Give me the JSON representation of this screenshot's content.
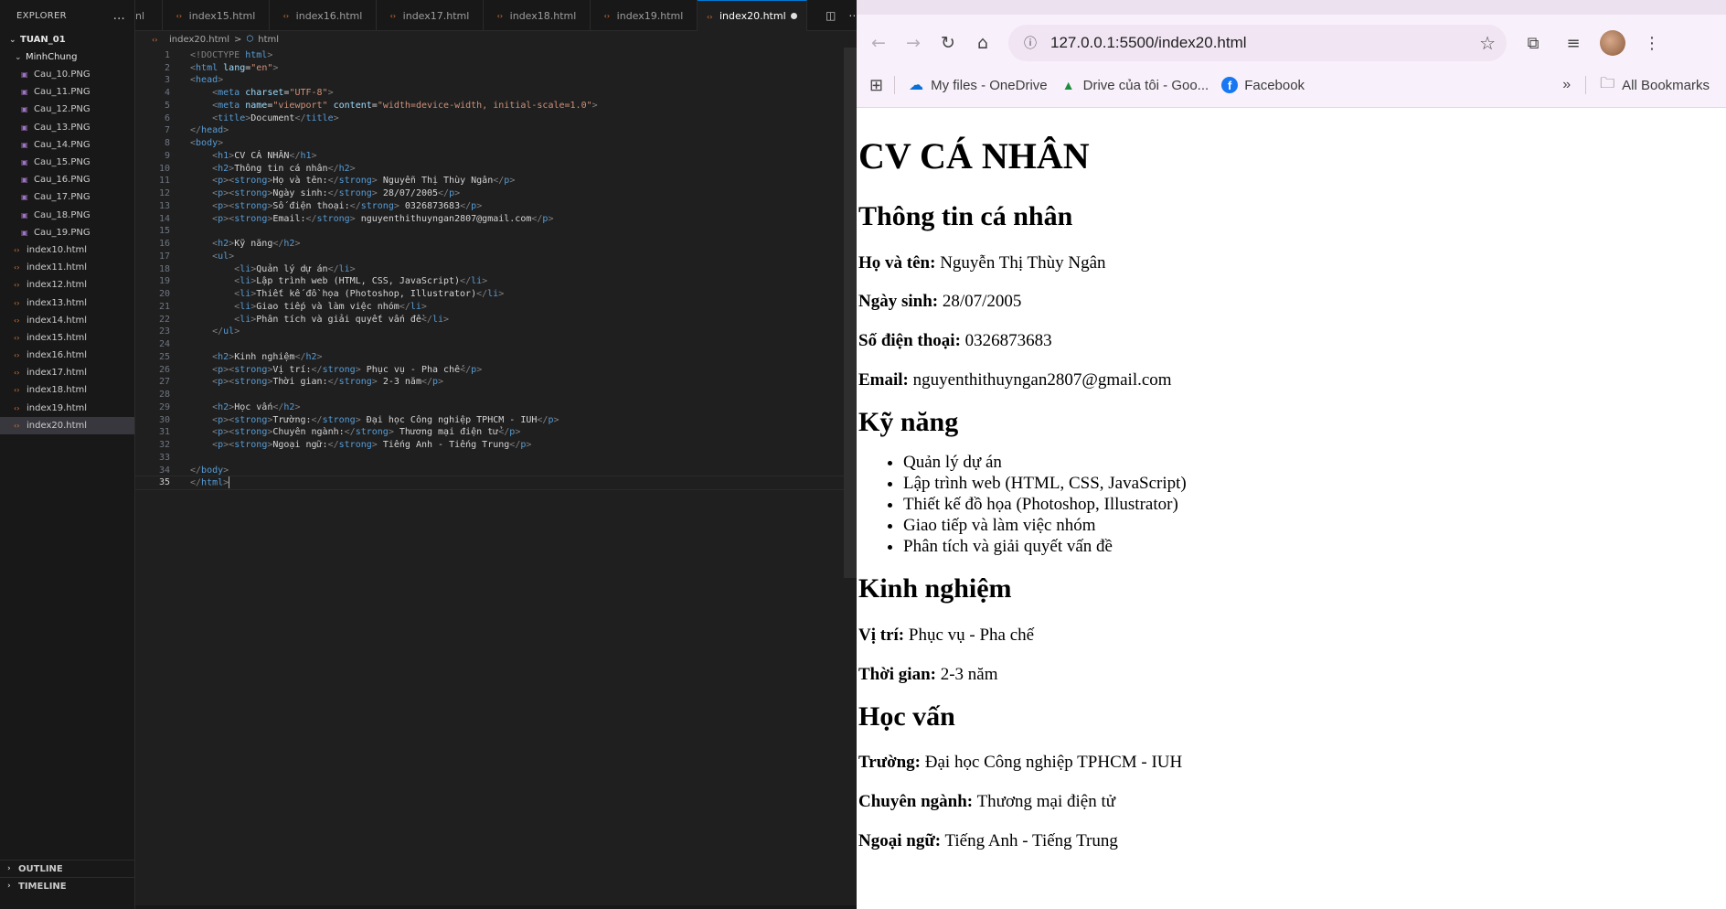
{
  "vscode": {
    "explorer_title": "EXPLORER",
    "more_icon": "...",
    "workspace": "TUAN_01",
    "subfolder": "MinhChung",
    "png_files": [
      "Cau_10.PNG",
      "Cau_11.PNG",
      "Cau_12.PNG",
      "Cau_13.PNG",
      "Cau_14.PNG",
      "Cau_15.PNG",
      "Cau_16.PNG",
      "Cau_17.PNG",
      "Cau_18.PNG",
      "Cau_19.PNG"
    ],
    "html_files": [
      "index10.html",
      "index11.html",
      "index12.html",
      "index13.html",
      "index14.html",
      "index15.html",
      "index16.html",
      "index17.html",
      "index18.html",
      "index19.html",
      "index20.html"
    ],
    "active_file": "index20.html",
    "outline_label": "OUTLINE",
    "timeline_label": "TIMELINE",
    "tabs": [
      "nl",
      "index15.html",
      "index16.html",
      "index17.html",
      "index18.html",
      "index19.html"
    ],
    "active_tab": "index20.html",
    "breadcrumb": {
      "file": "index20.html",
      "separator": ">",
      "symbol": "html"
    },
    "code_lines": [
      "<!DOCTYPE html>",
      "<html lang=\"en\">",
      "<head>",
      "    <meta charset=\"UTF-8\">",
      "    <meta name=\"viewport\" content=\"width=device-width, initial-scale=1.0\">",
      "    <title>Document</title>",
      "</head>",
      "<body>",
      "    <h1>CV CÁ NHÂN</h1>",
      "    <h2>Thông tin cá nhân</h2>",
      "    <p><strong>Họ và tên:</strong> Nguyễn Thị Thùy Ngân</p>",
      "    <p><strong>Ngày sinh:</strong> 28/07/2005</p>",
      "    <p><strong>Số điện thoại:</strong> 0326873683</p>",
      "    <p><strong>Email:</strong> nguyenthithuyngan2807@gmail.com</p>",
      "",
      "    <h2>Kỹ năng</h2>",
      "    <ul>",
      "        <li>Quản lý dự án</li>",
      "        <li>Lập trình web (HTML, CSS, JavaScript)</li>",
      "        <li>Thiết kế đồ họa (Photoshop, Illustrator)</li>",
      "        <li>Giao tiếp và làm việc nhóm</li>",
      "        <li>Phân tích và giải quyết vấn đề</li>",
      "    </ul>",
      "",
      "    <h2>Kinh nghiệm</h2>",
      "    <p><strong>Vị trí:</strong> Phục vụ - Pha chế</p>",
      "    <p><strong>Thời gian:</strong> 2-3 năm</p>",
      "",
      "    <h2>Học vấn</h2>",
      "    <p><strong>Trường:</strong> Đại học Công nghiệp TPHCM - IUH</p>",
      "    <p><strong>Chuyên ngành:</strong> Thương mại điện tử</p>",
      "    <p><strong>Ngoại ngữ:</strong> Tiếng Anh - Tiếng Trung</p>",
      "",
      "</body>",
      "</html>"
    ],
    "current_line": 35
  },
  "browser": {
    "url": "127.0.0.1:5500/index20.html",
    "bookmarks": [
      {
        "label": "My files - OneDrive",
        "icon": "onedrive-icon"
      },
      {
        "label": "Drive của tôi - Goo...",
        "icon": "google-drive-icon"
      },
      {
        "label": "Facebook",
        "icon": "facebook-icon"
      }
    ],
    "all_bookmarks": "All Bookmarks",
    "page": {
      "h1": "CV CÁ NHÂN",
      "sec_personal": "Thông tin cá nhân",
      "name_label": "Họ và tên:",
      "name_value": "Nguyễn Thị Thùy Ngân",
      "dob_label": "Ngày sinh:",
      "dob_value": "28/07/2005",
      "phone_label": "Số điện thoại:",
      "phone_value": "0326873683",
      "email_label": "Email:",
      "email_value": "nguyenthithuyngan2807@gmail.com",
      "sec_skills": "Kỹ năng",
      "skills": [
        "Quản lý dự án",
        "Lập trình web (HTML, CSS, JavaScript)",
        "Thiết kế đồ họa (Photoshop, Illustrator)",
        "Giao tiếp và làm việc nhóm",
        "Phân tích và giải quyết vấn đề"
      ],
      "sec_exp": "Kinh nghiệm",
      "pos_label": "Vị trí:",
      "pos_value": "Phục vụ - Pha chế",
      "time_label": "Thời gian:",
      "time_value": "2-3 năm",
      "sec_edu": "Học vấn",
      "school_label": "Trường:",
      "school_value": "Đại học Công nghiệp TPHCM - IUH",
      "major_label": "Chuyên ngành:",
      "major_value": "Thương mại điện tử",
      "lang_label": "Ngoại ngữ:",
      "lang_value": "Tiếng Anh - Tiếng Trung"
    }
  }
}
